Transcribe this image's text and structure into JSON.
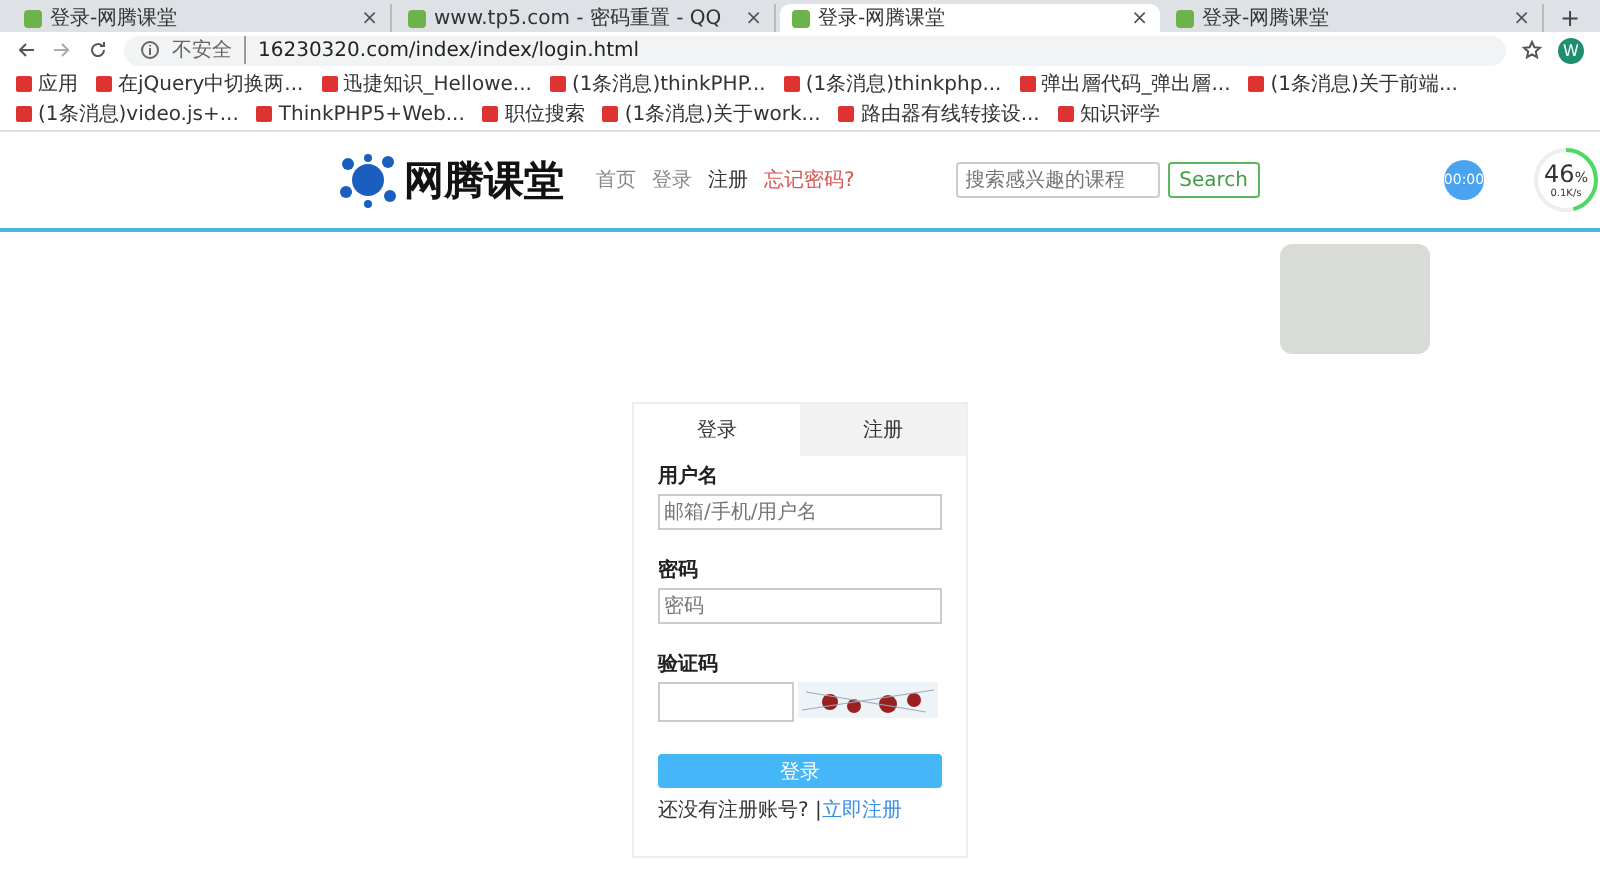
{
  "browser": {
    "tabs": [
      {
        "title": "登录-网腾课堂",
        "selected": false,
        "close": "×"
      },
      {
        "title": "www.tp5.com - 密码重置 - QQ",
        "selected": false,
        "close": "×"
      },
      {
        "title": "登录-网腾课堂",
        "selected": true,
        "close": "×"
      },
      {
        "title": "登录-网腾课堂",
        "selected": false,
        "close": "×"
      }
    ],
    "new_tab": "+",
    "security": "不安全",
    "url": "16230320.com/index/index/login.html",
    "profile": "W",
    "bookmarks": [
      "应用",
      "在jQuery中切换两...",
      "迅捷知识_Hellowe...",
      "(1条消息)thinkPHP...",
      "(1条消息)thinkphp...",
      "弹出層代码_弹出層...",
      "(1条消息)关于前端...",
      "(1条消息)video.js+...",
      "ThinkPHP5+Web...",
      "职位搜索",
      "(1条消息)关于work...",
      "路由器有线转接设...",
      "知识评学"
    ]
  },
  "header": {
    "logo": "网腾课堂",
    "nav": [
      {
        "label": "首页",
        "kind": "plain"
      },
      {
        "label": "登录",
        "kind": "plain"
      },
      {
        "label": "注册",
        "kind": "strong"
      },
      {
        "label": "忘记密码?",
        "kind": "alert"
      }
    ],
    "search": {
      "placeholder": "搜索感兴趣的课程",
      "button": "Search"
    },
    "timer": "00:00",
    "meter": {
      "percent": "46",
      "unit": "%",
      "speed": "0.1K/s",
      "level": 0.46
    }
  },
  "login": {
    "tabs": [
      {
        "label": "登录",
        "selected": true
      },
      {
        "label": "注册",
        "selected": false
      }
    ],
    "fields": [
      {
        "label": "用户名",
        "placeholder": "邮箱/手机/用户名"
      },
      {
        "label": "密码",
        "placeholder": "密码"
      }
    ],
    "captcha_label": "验证码",
    "submit": "登录",
    "prompt": "还没有注册账号? |",
    "register_link": "立即注册"
  }
}
